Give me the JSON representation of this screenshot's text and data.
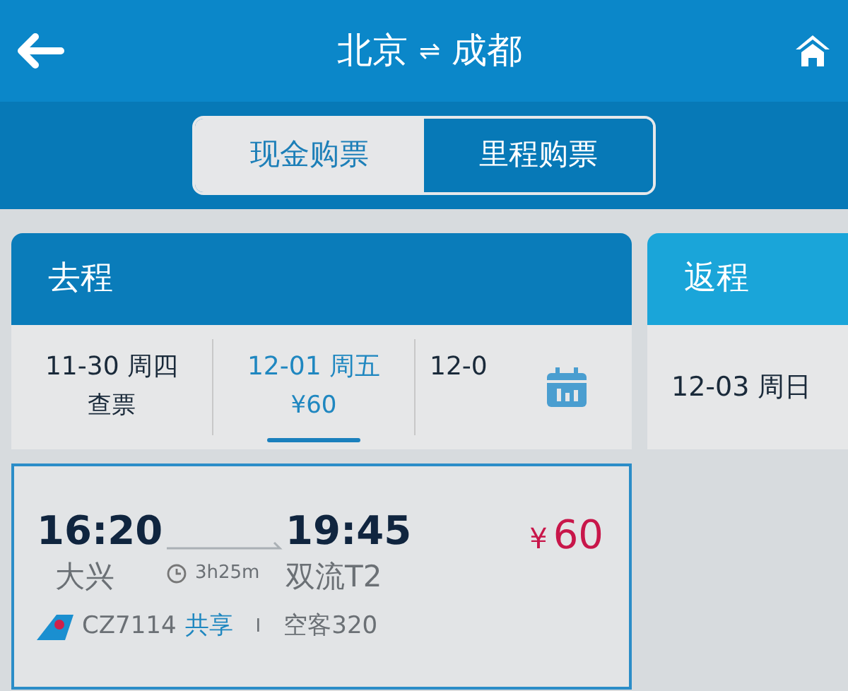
{
  "header": {
    "from": "北京",
    "swap": "⇌",
    "to": "成都"
  },
  "ticket_tabs": [
    {
      "label": "现金购票",
      "selected": true
    },
    {
      "label": "里程购票",
      "selected": false
    }
  ],
  "outbound": {
    "title": "去程",
    "dates": [
      {
        "date": "11-30 周四",
        "sub": "查票",
        "selected": false
      },
      {
        "date": "12-01 周五",
        "sub": "¥60",
        "selected": true
      },
      {
        "date": "12-0",
        "selected": false
      }
    ]
  },
  "return": {
    "title": "返程",
    "date": "12-03 周日"
  },
  "flight": {
    "depart_time": "16:20",
    "depart_airport": "大兴",
    "duration": "3h25m",
    "arrive_time": "19:45",
    "arrive_airport": "双流T2",
    "price_symbol": "¥",
    "price": "60",
    "flight_no": "CZ7114",
    "share": "共享",
    "separator": "I",
    "aircraft": "空客320"
  }
}
